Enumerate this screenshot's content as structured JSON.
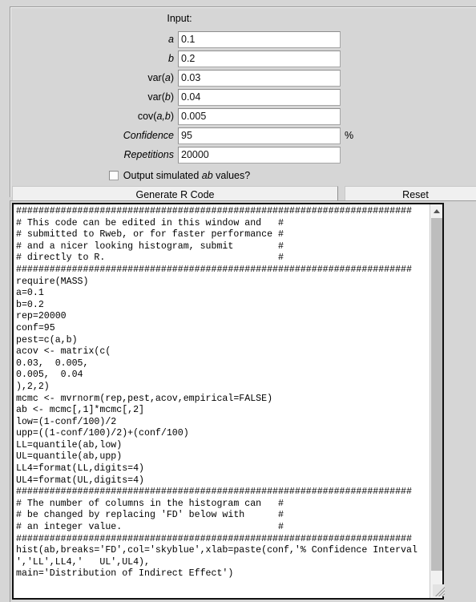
{
  "panel": {
    "title": "Input:",
    "fields": [
      {
        "name": "a",
        "label_pre": "",
        "label_ital": "a",
        "label_post": "",
        "value": "0.1",
        "suffix": ""
      },
      {
        "name": "b",
        "label_pre": "",
        "label_ital": "b",
        "label_post": "",
        "value": "0.2",
        "suffix": ""
      },
      {
        "name": "var-a",
        "label_pre": "var(",
        "label_ital": "a",
        "label_post": ")",
        "value": "0.03",
        "suffix": ""
      },
      {
        "name": "var-b",
        "label_pre": "var(",
        "label_ital": "b",
        "label_post": ")",
        "value": "0.04",
        "suffix": ""
      },
      {
        "name": "cov-ab",
        "label_pre": "cov(",
        "label_ital": "a,b",
        "label_post": ")",
        "value": "0.005",
        "suffix": ""
      },
      {
        "name": "confidence",
        "label_pre": "",
        "label_ital": "Confidence",
        "label_post": "",
        "value": "95",
        "suffix": "%"
      },
      {
        "name": "repetitions",
        "label_pre": "",
        "label_ital": "Repetitions",
        "label_post": "",
        "value": "20000",
        "suffix": ""
      }
    ],
    "checkbox": {
      "text_before": "Output simulated ",
      "text_ital": "ab",
      "text_after": " values?",
      "checked": false
    },
    "buttons": {
      "generate_label": "Generate R Code",
      "reset_label": "Reset"
    }
  },
  "code": {
    "content": "#######################################################################\n# This code can be edited in this window and   #\n# submitted to Rweb, or for faster performance #\n# and a nicer looking histogram, submit        #\n# directly to R.                               #\n#######################################################################\nrequire(MASS)\na=0.1\nb=0.2\nrep=20000\nconf=95\npest=c(a,b)\nacov <- matrix(c(\n0.03,  0.005,\n0.005,  0.04\n),2,2)\nmcmc <- mvrnorm(rep,pest,acov,empirical=FALSE)\nab <- mcmc[,1]*mcmc[,2]\nlow=(1-conf/100)/2\nupp=((1-conf/100)/2)+(conf/100)\nLL=quantile(ab,low)\nUL=quantile(ab,upp)\nLL4=format(LL,digits=4)\nUL4=format(UL,digits=4)\n#######################################################################\n# The number of columns in the histogram can   #\n# be changed by replacing 'FD' below with      #\n# an integer value.                            #\n#######################################################################\nhist(ab,breaks='FD',col='skyblue',xlab=paste(conf,'% Confidence Interval\n','LL',LL4,'   UL',UL4),\nmain='Distribution of Indirect Effect')"
  },
  "scrollbar": {
    "up_arrow": "scroll-up",
    "down_arrow": "scroll-down"
  },
  "colors": {
    "panel_bg": "#d6d6d6",
    "code_bg": "#ffffff",
    "code_fg": "#000000",
    "button_bg": "#f0f0f0"
  }
}
